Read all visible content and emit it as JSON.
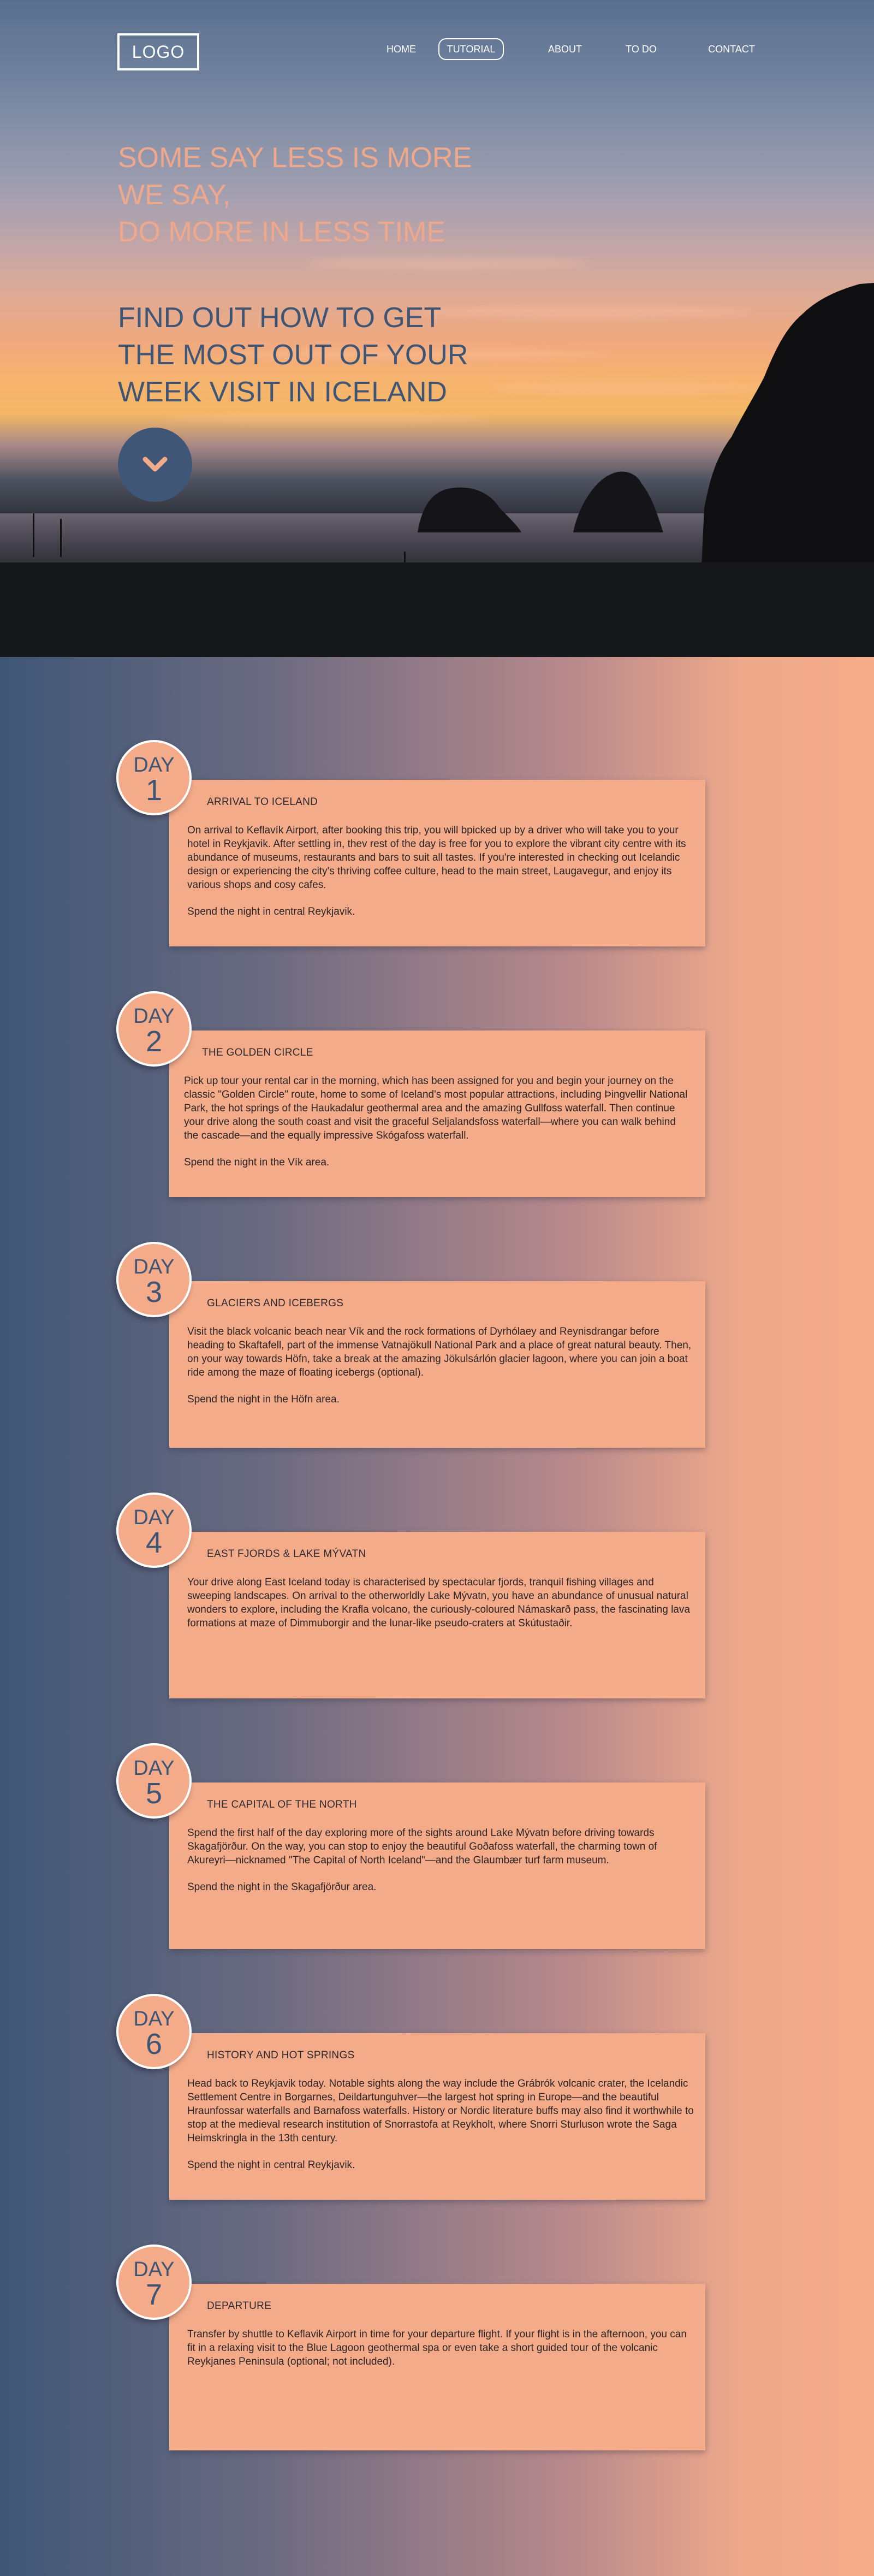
{
  "header": {
    "logo": "LOGO",
    "nav": [
      {
        "label": "HOME",
        "active": false
      },
      {
        "label": "TUTORIAL",
        "active": true
      },
      {
        "label": "ABOUT",
        "active": false
      },
      {
        "label": "TO DO",
        "active": false
      },
      {
        "label": "CONTACT",
        "active": false
      }
    ]
  },
  "hero": {
    "tagline": "SOME SAY LESS IS MORE\nWE SAY,\nDO MORE IN LESS TIME",
    "headline": "FIND OUT HOW TO GET\nTHE MOST OUT OF YOUR\nWEEK VISIT IN ICELAND",
    "scroll_icon": "chevron-down-icon"
  },
  "colors": {
    "accent": "#f3ab89",
    "navy": "#3f5676",
    "white": "#ffffff"
  },
  "days": [
    {
      "word": "DAY",
      "num": "1",
      "title": "ARRIVAL TO ICELAND",
      "body": "On arrival to Keflavík Airport, after booking this trip, you will bpicked up by a driver who will take you to your hotel in Reykjavik. After settling in, thev rest of the day is free for you to explore the vibrant city centre with its abundance of museums, restaurants and bars to suit all tastes. If you're interested in checking out Icelandic design or experiencing the city's thriving coffee culture, head to the main street, Laugavegur, and enjoy its various shops and cosy cafes.",
      "night": "Spend the night in central Reykjavik."
    },
    {
      "word": "DAY",
      "num": "2",
      "title": "THE GOLDEN CIRCLE",
      "body": "Pick up tour your rental car in the morning, which has been assigned for you and begin your journey on the classic \"Golden Circle\" route, home to some of Iceland's most popular attractions, including Þingvellir National Park, the hot springs of the Haukadalur geothermal area and the amazing Gullfoss waterfall. Then continue your drive along the south coast and visit the graceful Seljalandsfoss waterfall—where you can walk behind the cascade—and the equally impressive Skógafoss waterfall.",
      "night": "Spend the night in the Vík area."
    },
    {
      "word": "DAY",
      "num": "3",
      "title": "GLACIERS AND ICEBERGS",
      "body": "Visit the black volcanic beach near Vík and the rock formations of Dyrhólaey and Reynisdrangar before heading to Skaftafell, part of the immense Vatnajökull National Park and a place of great natural beauty. Then, on your way towards Höfn, take a break at the amazing Jökulsárlón glacier lagoon, where you can join a boat ride among the maze of floating icebergs (optional).",
      "night": "Spend the night in the Höfn area."
    },
    {
      "word": "DAY",
      "num": "4",
      "title": "EAST FJORDS & LAKE MÝVATN",
      "body": "Your drive along East Iceland today is characterised by spectacular fjords, tranquil fishing villages and sweeping landscapes. On arrival to the otherworldly Lake Mývatn, you have an abundance of unusual natural wonders to explore, including the Krafla volcano, the curiously-coloured Námaskarð pass, the fascinating lava formations at maze of Dimmuborgir and the lunar-like pseudo-craters at Skútustaðir.",
      "night": ""
    },
    {
      "word": "DAY",
      "num": "5",
      "title": "THE CAPITAL OF THE NORTH",
      "body": "Spend the first half of the day exploring more of the sights around Lake Mývatn before driving towards Skagafjörður. On the way, you can stop to enjoy the beautiful Goðafoss waterfall, the charming town of Akureyri—nicknamed \"The Capital of North Iceland\"—and the Glaumbær turf farm museum.",
      "night": "Spend the night in the Skagafjörður area."
    },
    {
      "word": "DAY",
      "num": "6",
      "title": "HISTORY AND HOT SPRINGS",
      "body": "Head back to Reykjavik today. Notable sights along the way include the Grábrók volcanic crater, the Icelandic Settlement Centre in Borgarnes, Deildartunguhver—the largest hot spring in Europe—and the beautiful Hraunfossar waterfalls and Barnafoss waterfalls. History or Nordic literature buffs may also find it worthwhile to stop at the medieval research institution of Snorrastofa at Reykholt, where Snorri Sturluson wrote the Saga Heimskringla in the 13th century.",
      "night": "Spend the night in central Reykjavik."
    },
    {
      "word": "DAY",
      "num": "7",
      "title": "DEPARTURE",
      "body": "Transfer by shuttle to Keflavik Airport in time for your departure flight. If your flight is in the afternoon, you can fit in a relaxing visit to the Blue Lagoon geothermal spa or even take a short guided tour of the volcanic Reykjanes Peninsula (optional; not included).",
      "night": ""
    }
  ]
}
